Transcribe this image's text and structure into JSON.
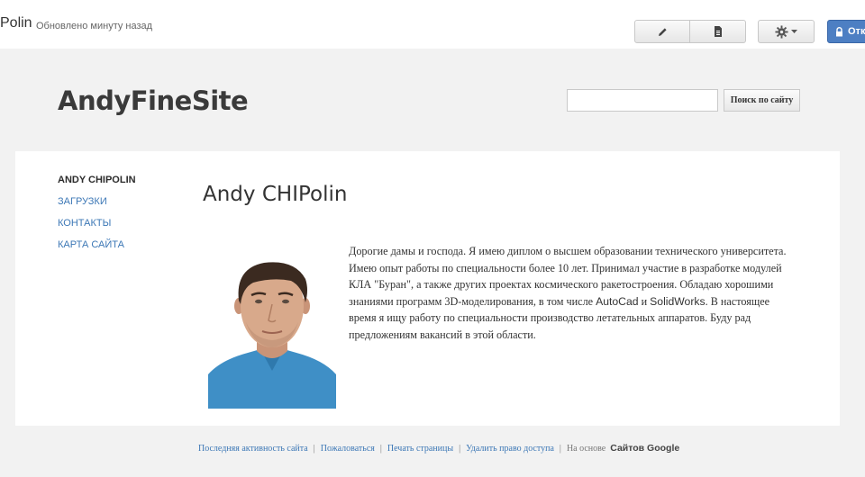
{
  "topbar": {
    "title": "Polin",
    "updated": "Обновлено минуту назад",
    "open_label": "Откр",
    "icons": {
      "edit": "pencil-icon",
      "page": "document-icon",
      "settings": "gear-icon",
      "lock": "lock-icon"
    }
  },
  "header": {
    "site_title": "AndyFineSite",
    "search_placeholder": "",
    "search_button": "Поиск по сайту"
  },
  "nav": {
    "items": [
      {
        "label": "ANDY CHIPOLIN"
      },
      {
        "label": "ЗАГРУЗКИ"
      },
      {
        "label": "КОНТАКТЫ"
      },
      {
        "label": "КАРТА САЙТА"
      }
    ]
  },
  "main": {
    "page_title": "Andy CHIPolin",
    "bio": {
      "part1": "Дорогие дамы и господа. Я имею диплом о высшем образовании технического университета. Имею опыт работы по специальности более 10 лет. Принимал участие в разработке модулей КЛА \"Буран\", а также других проектах космического ракетостроения. Обладаю хорошими знаниями программ 3D-моделирования, в том числе ",
      "autocad": "AutoCad",
      "and": " и ",
      "solidworks": "SolidWorks",
      "part2": ".  В настоящее время я ищу работу по специальности производство летательных аппаратов. Буду рад предложениям вакансий в этой области."
    }
  },
  "footer": {
    "links": [
      "Последняя активность сайта",
      "Пожаловаться",
      "Печать страницы",
      "Удалить право доступа"
    ],
    "based_on": "На основе",
    "google_sites": "Сайтов Google"
  }
}
